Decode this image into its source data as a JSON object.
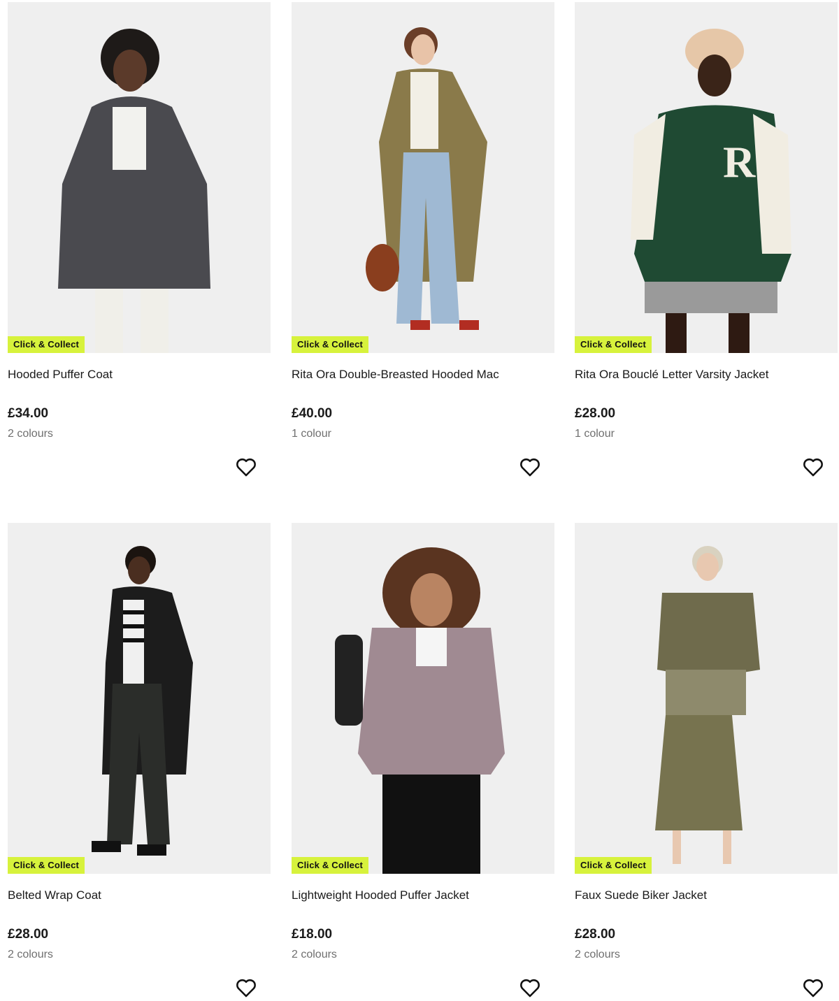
{
  "products": [
    {
      "name": "Hooded Puffer Coat",
      "price": "£34.00",
      "colours": "2 colours",
      "badge": "Click & Collect",
      "coat_color": "#4a4a4f",
      "icon": "heart-outline-icon"
    },
    {
      "name": "Rita Ora Double-Breasted Hooded Mac",
      "price": "£40.00",
      "colours": "1 colour",
      "badge": "Click & Collect",
      "coat_color": "#8a7a4a",
      "icon": "heart-outline-icon"
    },
    {
      "name": "Rita Ora Bouclé Letter Varsity Jacket",
      "price": "£28.00",
      "colours": "1 colour",
      "badge": "Click & Collect",
      "coat_color": "#1f4a33",
      "icon": "heart-outline-icon"
    },
    {
      "name": "Belted Wrap Coat",
      "price": "£28.00",
      "colours": "2 colours",
      "badge": "Click & Collect",
      "coat_color": "#1c1c1c",
      "icon": "heart-outline-icon"
    },
    {
      "name": "Lightweight Hooded Puffer Jacket",
      "price": "£18.00",
      "colours": "2 colours",
      "badge": "Click & Collect",
      "coat_color": "#a08a92",
      "icon": "heart-outline-icon"
    },
    {
      "name": "Faux Suede Biker Jacket",
      "price": "£28.00",
      "colours": "2 colours",
      "badge": "Click & Collect",
      "coat_color": "#6f6b4c",
      "icon": "heart-outline-icon"
    }
  ],
  "colors": {
    "badge_bg": "#d7f23c",
    "photo_bg": "#efefef"
  }
}
